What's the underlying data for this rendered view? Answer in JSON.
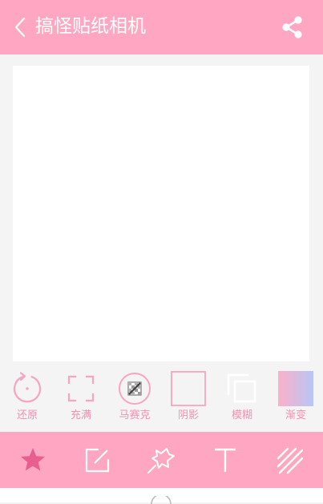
{
  "header": {
    "title": "搞怪贴纸相机",
    "back_icon": "chevron-left-icon",
    "share_icon": "share-icon",
    "background_color": "#ffa6c2"
  },
  "tools": [
    {
      "label": "还原",
      "icon": "restore-icon"
    },
    {
      "label": "充满",
      "icon": "fill-frame-icon"
    },
    {
      "label": "马赛克",
      "icon": "mosaic-icon"
    },
    {
      "label": "阴影",
      "icon": "shadow-icon"
    },
    {
      "label": "模糊",
      "icon": "blur-icon"
    },
    {
      "label": "渐变",
      "icon": "gradient-icon"
    }
  ],
  "bottom_bar": {
    "items": [
      {
        "icon": "star-icon",
        "selected": true
      },
      {
        "icon": "edit-icon",
        "selected": false
      },
      {
        "icon": "sticker-icon",
        "selected": false
      },
      {
        "icon": "text-icon",
        "selected": false
      },
      {
        "icon": "stripes-icon",
        "selected": false
      }
    ]
  },
  "colors": {
    "accent": "#ffa6c2",
    "label": "#f590b2",
    "selected_icon": "#e85f8d",
    "gradient_start": "#fdb0c8",
    "gradient_end": "#b7c6f6"
  }
}
